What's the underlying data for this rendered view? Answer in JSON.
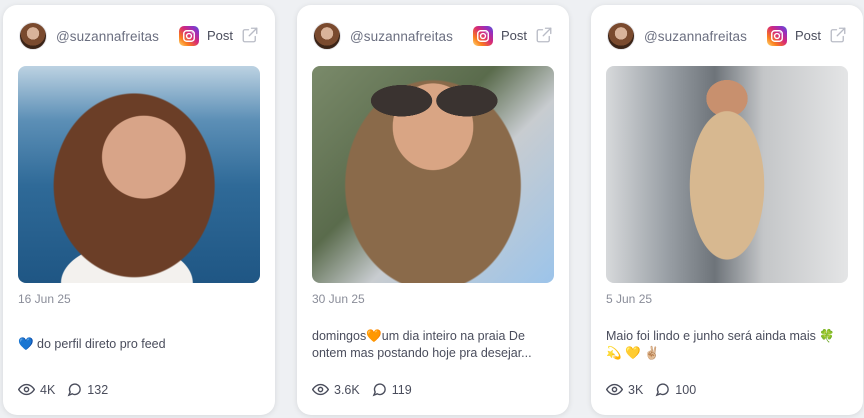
{
  "posts": [
    {
      "handle": "@suzannafreitas",
      "type_label": "Post",
      "platform_icon": "instagram-icon",
      "date": "16 Jun 25",
      "caption": "💙 do perfil direto pro feed",
      "views": "4K",
      "comments": "132"
    },
    {
      "handle": "@suzannafreitas",
      "type_label": "Post",
      "platform_icon": "instagram-icon",
      "date": "30 Jun 25",
      "caption": "domingos🧡um dia inteiro na praia De ontem mas postando hoje pra desejar...",
      "views": "3.6K",
      "comments": "119"
    },
    {
      "handle": "@suzannafreitas",
      "type_label": "Post",
      "platform_icon": "instagram-icon",
      "date": "5 Jun 25",
      "caption": "Maio foi lindo e junho será ainda mais 🍀 💫 💛 ✌🏼",
      "views": "3K",
      "comments": "100"
    }
  ],
  "colors": {
    "card_bg": "#ffffff",
    "page_bg": "#eef0f3",
    "text_muted": "#8a8d99",
    "text_primary": "#4a4d5c"
  }
}
